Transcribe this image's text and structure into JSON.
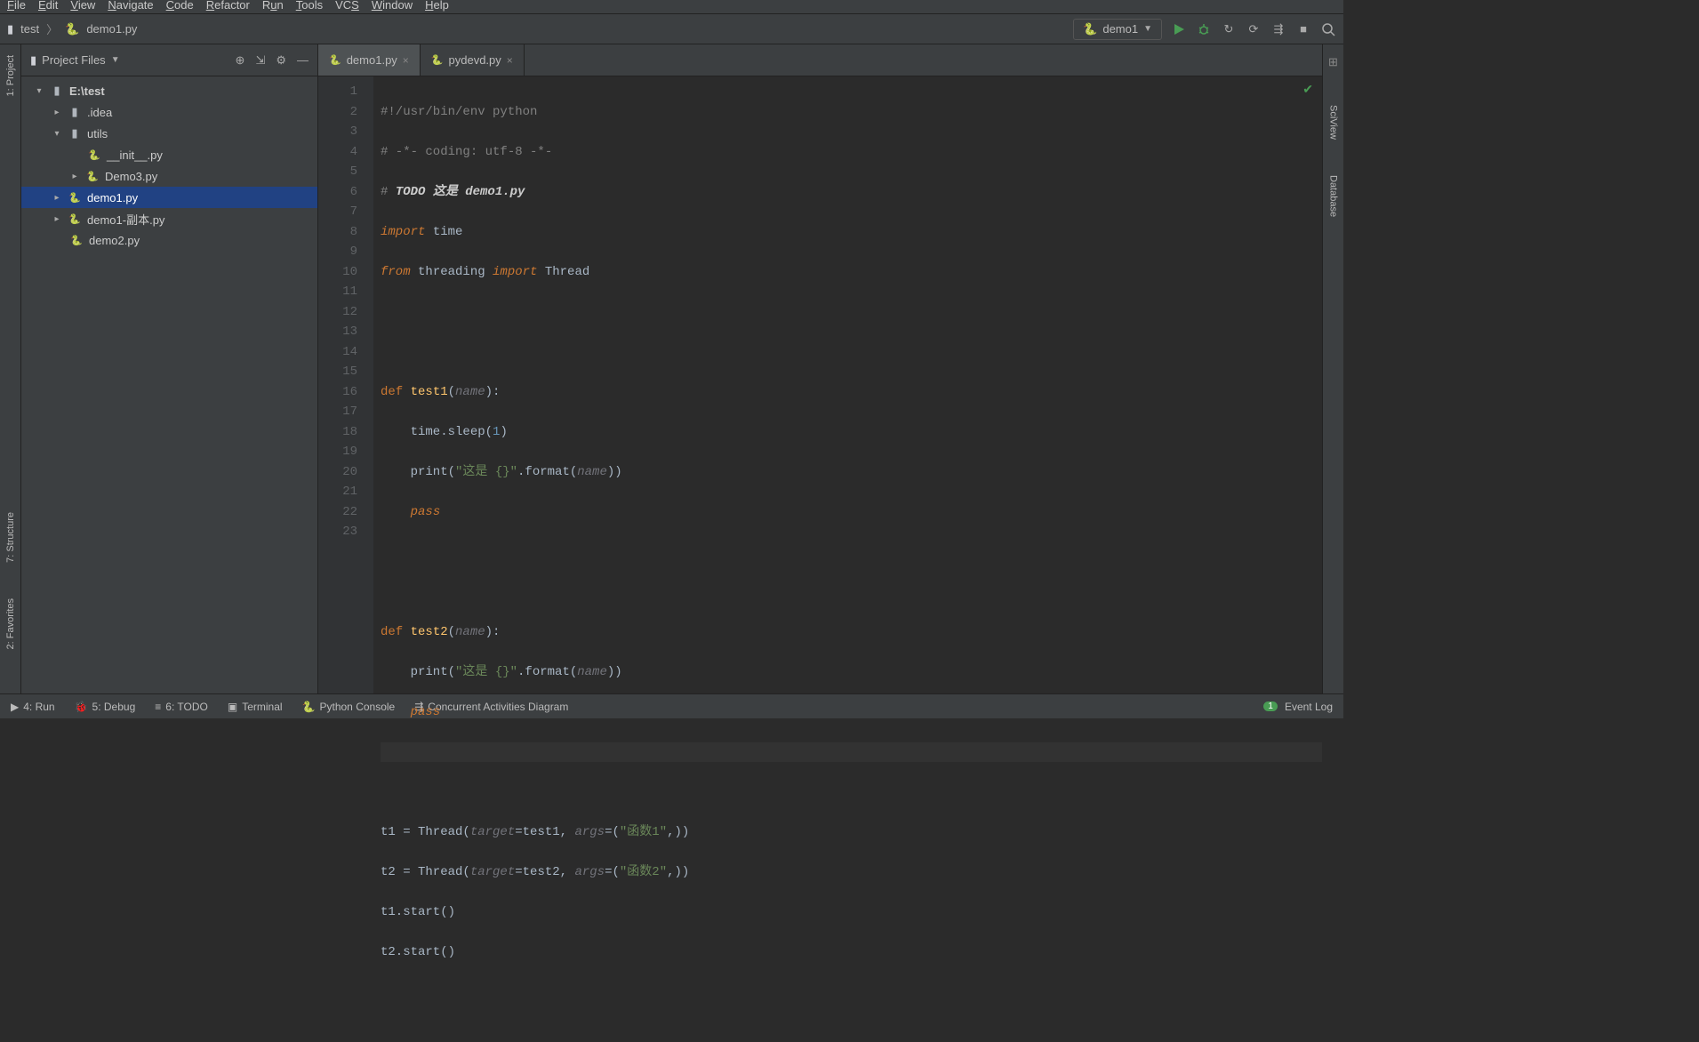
{
  "menu": {
    "file": "File",
    "edit": "Edit",
    "view": "View",
    "navigate": "Navigate",
    "code": "Code",
    "refactor": "Refactor",
    "run": "Run",
    "tools": "Tools",
    "vcs": "VCS",
    "window": "Window",
    "help": "Help"
  },
  "breadcrumb": {
    "root": "test",
    "file": "demo1.py"
  },
  "run_config": "demo1",
  "panel_title": "Project Files",
  "tree": {
    "root": "E:\\test",
    "n1": ".idea",
    "n2": "utils",
    "n3": "__init__.py",
    "n4": "Demo3.py",
    "n5": "demo1.py",
    "n6": "demo1-副本.py",
    "n7": "demo2.py"
  },
  "tabs": {
    "t1": "demo1.py",
    "t2": "pydevd.py"
  },
  "gutter": {
    "lines": [
      "1",
      "2",
      "3",
      "4",
      "5",
      "6",
      "7",
      "8",
      "9",
      "10",
      "11",
      "12",
      "13",
      "14",
      "15",
      "16",
      "17",
      "18",
      "19",
      "20",
      "21",
      "22",
      "23"
    ]
  },
  "code": {
    "l1a": "#!/usr/bin/env python",
    "l2a": "# -*- coding: utf-8 -*-",
    "l3a": "# ",
    "l3b": "TODO 这是 demo1.py",
    "l4a": "import ",
    "l4b": "time",
    "l5a": "from ",
    "l5b": "threading ",
    "l5c": "import ",
    "l5d": "Thread",
    "l8a": "def ",
    "l8b": "test1",
    "l8c": "(",
    "l8d": "name",
    "l8e": "):",
    "l9a": "    time.sleep(",
    "l9b": "1",
    "l9c": ")",
    "l10a": "    print(",
    "l10b": "\"这是 {}\"",
    "l10c": ".format(",
    "l10d": "name",
    "l10e": "))",
    "l11a": "    ",
    "l11b": "pass",
    "l14a": "def ",
    "l14b": "test2",
    "l14c": "(",
    "l14d": "name",
    "l14e": "):",
    "l15a": "    print(",
    "l15b": "\"这是 {}\"",
    "l15c": ".format(",
    "l15d": "name",
    "l15e": "))",
    "l16a": "    ",
    "l16b": "pass",
    "l19a": "t1 = Thread(",
    "l19b": "target",
    "l19c": "=test1, ",
    "l19d": "args",
    "l19e": "=(",
    "l19f": "\"函数1\"",
    "l19g": ",))",
    "l20a": "t2 = Thread(",
    "l20b": "target",
    "l20c": "=test2, ",
    "l20d": "args",
    "l20e": "=(",
    "l20f": "\"函数2\"",
    "l20g": ",))",
    "l21a": "t1.start()",
    "l22a": "t2.start()"
  },
  "siderail": {
    "project": "1: Project",
    "structure": "7: Structure",
    "favorites": "2: Favorites",
    "sciview": "SciView",
    "database": "Database"
  },
  "status": {
    "run": "4: Run",
    "debug": "5: Debug",
    "todo": "6: TODO",
    "terminal": "Terminal",
    "pyconsole": "Python Console",
    "cad": "Concurrent Activities Diagram",
    "eventlog": "Event Log"
  }
}
